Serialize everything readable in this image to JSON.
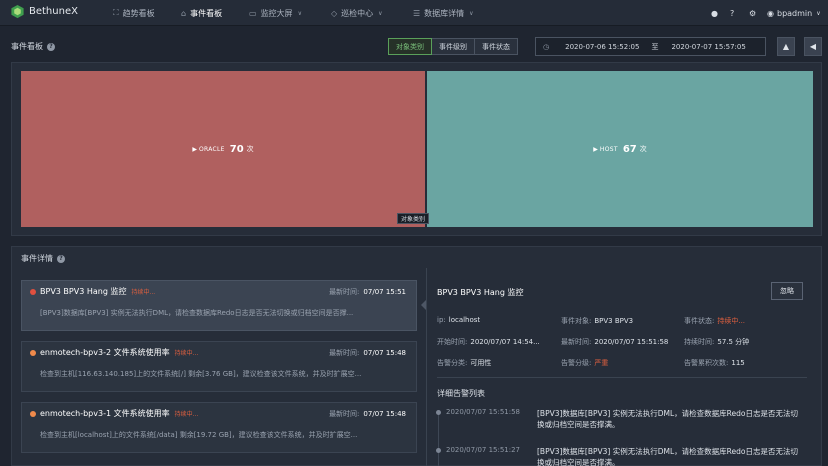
{
  "app": {
    "name": "BethuneX"
  },
  "nav": {
    "items": [
      {
        "label": "趋势看板",
        "icon": "trend-icon"
      },
      {
        "label": "事件看板",
        "icon": "bell-icon"
      },
      {
        "label": "监控大屏",
        "icon": "monitor-icon"
      },
      {
        "label": "巡检中心",
        "icon": "shield-icon"
      },
      {
        "label": "数据库详情",
        "icon": "database-icon"
      }
    ],
    "active_index": 1,
    "user": "bpadmin"
  },
  "board": {
    "title": "事件看板",
    "tabs": [
      "对象类别",
      "事件级别",
      "事件状态"
    ],
    "active_tab": 0,
    "date_start": "2020-07-06 15:52:05",
    "date_sep": "至",
    "date_end": "2020-07-07 15:57:05"
  },
  "treemap": {
    "cells": [
      {
        "label": "ORACLE",
        "count": "70",
        "unit": "次",
        "color": "#b0605f"
      },
      {
        "label": "HOST",
        "count": "67",
        "unit": "次",
        "color": "#6aa5a2"
      }
    ],
    "tooltip": "对象类别"
  },
  "details": {
    "title": "事件详情",
    "events": [
      {
        "title": "BPV3 BPV3 Hang 监控",
        "status": "持续中...",
        "time_label": "最新时间:",
        "time": "07/07 15:51",
        "desc": "[BPV3]数据库[BPV3] 实例无法执行DML，请检查数据库Redo日志是否无法切换或归档空间是否撑...",
        "dot_color": "#e0503f"
      },
      {
        "title": "enmotech-bpv3-2 文件系统使用率",
        "status": "持续中...",
        "time_label": "最新时间:",
        "time": "07/07 15:48",
        "desc": "检查到主机[116.63.140.185]上的文件系统[/] 剩余[3.76 GB]，建议检查该文件系统，并及时扩展空...",
        "dot_color": "#f08a4b"
      },
      {
        "title": "enmotech-bpv3-1 文件系统使用率",
        "status": "持续中...",
        "time_label": "最新时间:",
        "time": "07/07 15:48",
        "desc": "检查到主机[localhost]上的文件系统[/data] 剩余[19.72 GB]，建议检查该文件系统，并及时扩展空...",
        "dot_color": "#f08a4b"
      }
    ],
    "selected": {
      "title": "BPV3 BPV3 Hang 监控",
      "ignore_label": "忽略",
      "fields": {
        "ip_label": "ip:",
        "ip": "localhost",
        "object_label": "事件对象:",
        "object": "BPV3 BPV3",
        "state_label": "事件状态:",
        "state": "持续中...",
        "start_label": "开始时间:",
        "start": "2020/07/07 14:54...",
        "latest_label": "最新时间:",
        "latest": "2020/07/07 15:51:58",
        "duration_label": "持续时间:",
        "duration": "57.5 分钟",
        "category_label": "告警分类:",
        "category": "可用性",
        "level_label": "告警分级:",
        "level": "严重",
        "count_label": "告警累积次数:",
        "count": "115"
      },
      "alerts_title": "详细告警列表",
      "alerts": [
        {
          "time": "2020/07/07 15:51:58",
          "text": "[BPV3]数据库[BPV3] 实例无法执行DML，请检查数据库Redo日志是否无法切换或归档空间是否撑满。"
        },
        {
          "time": "2020/07/07 15:51:27",
          "text": "[BPV3]数据库[BPV3] 实例无法执行DML，请检查数据库Redo日志是否无法切换或归档空间是否撑满。"
        }
      ]
    }
  }
}
